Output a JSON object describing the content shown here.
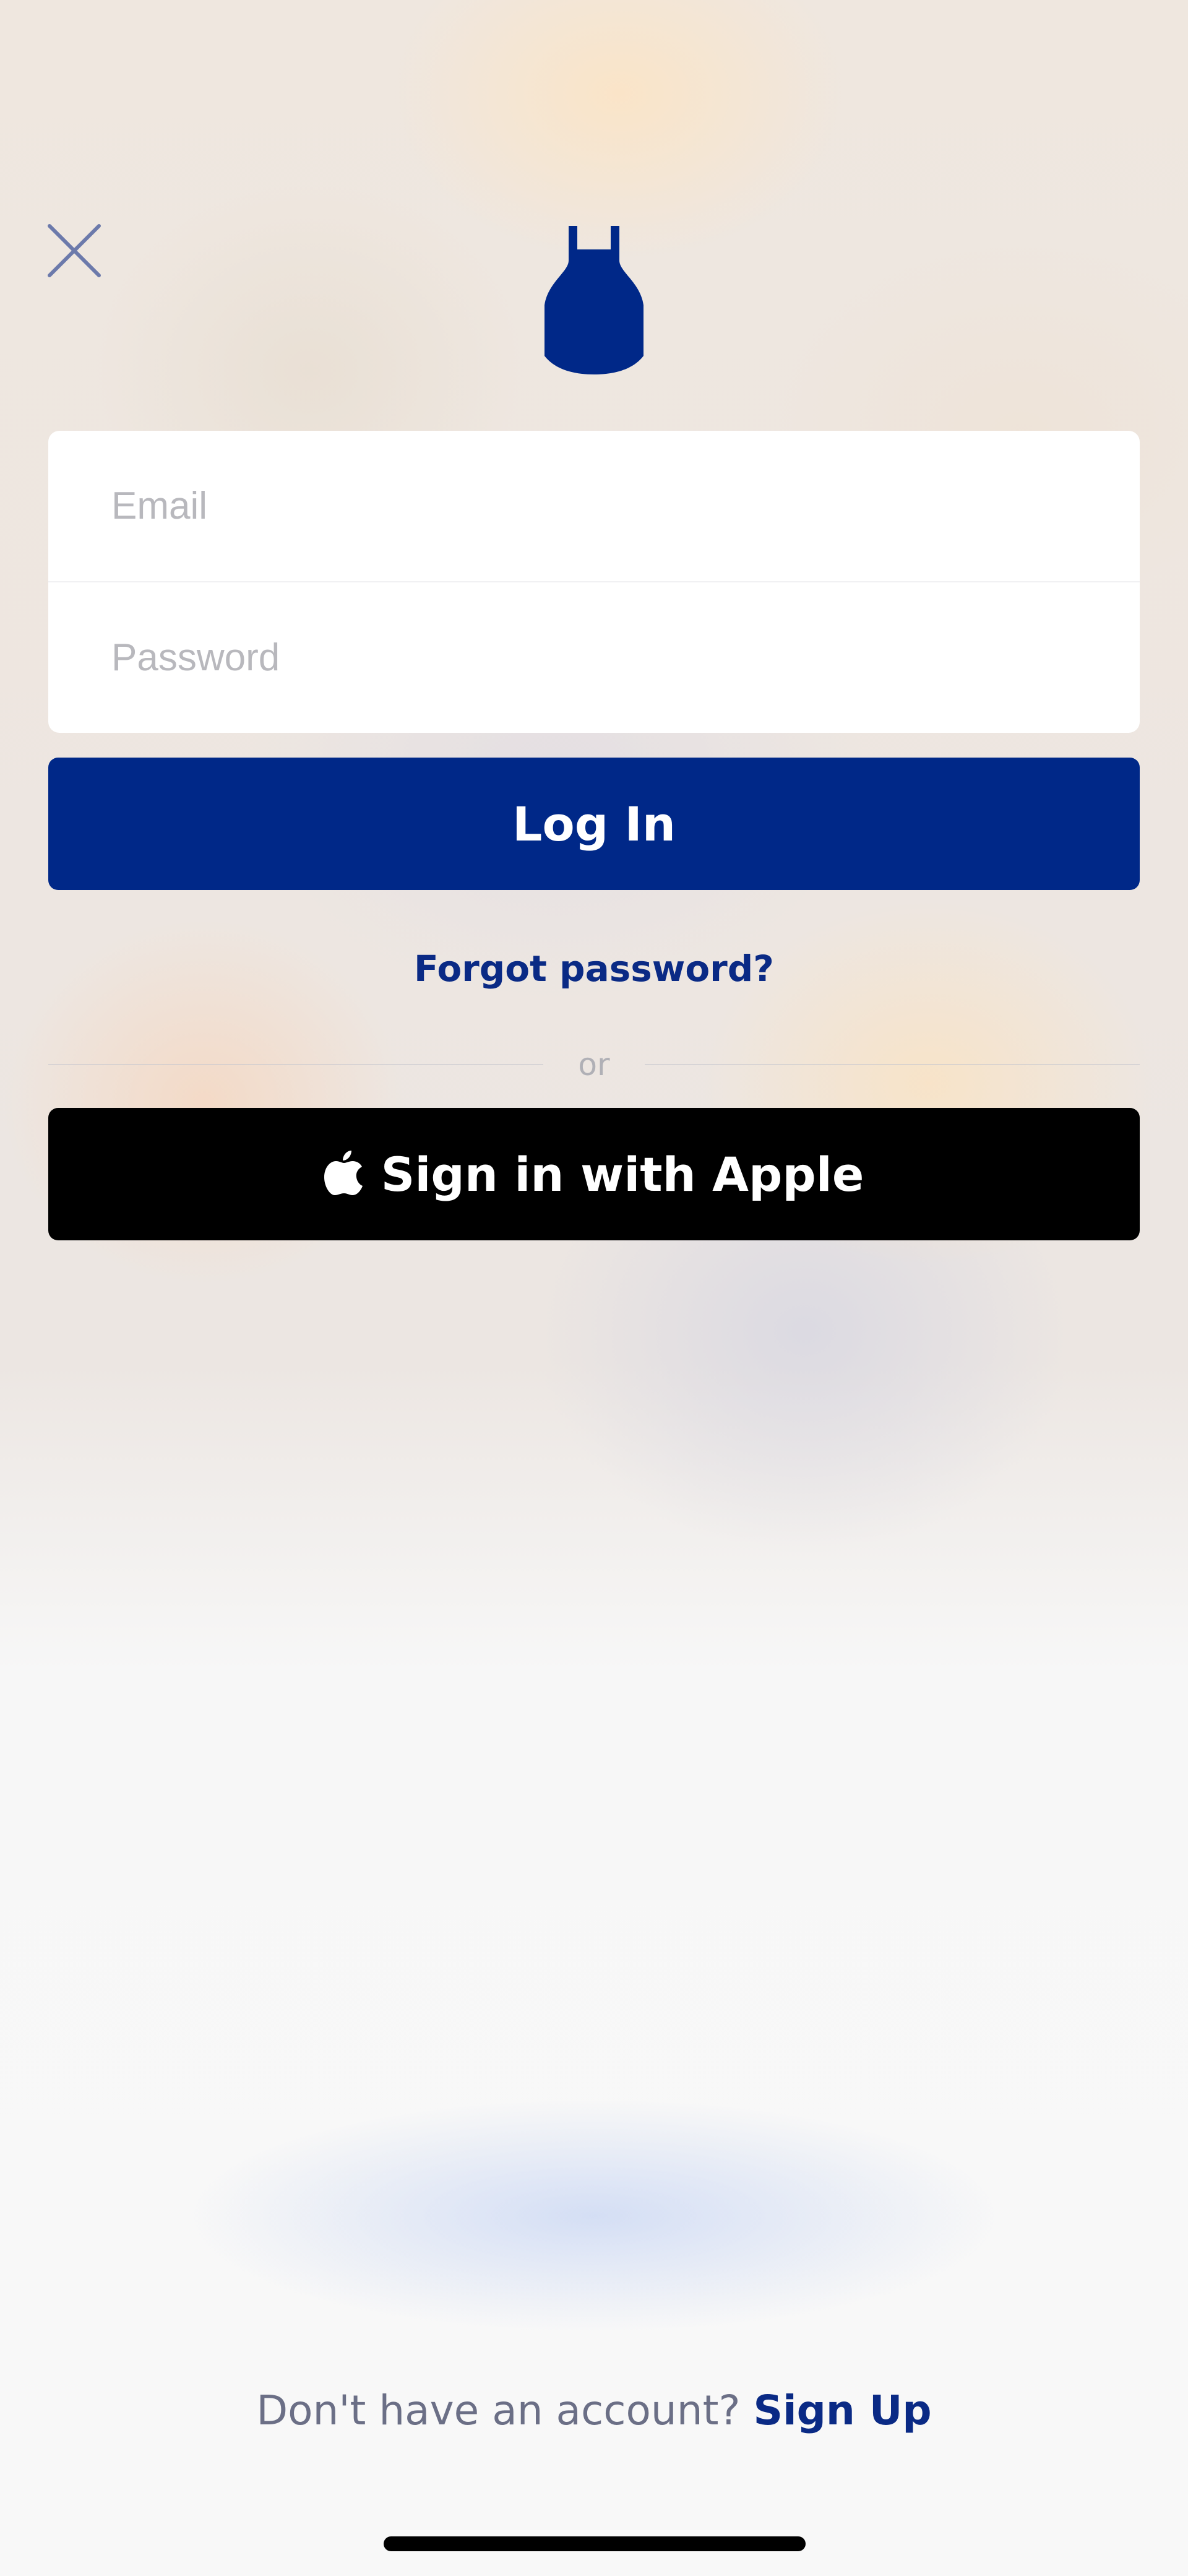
{
  "header": {
    "close_icon": "close-icon",
    "logo_icon": "apron-logo-icon"
  },
  "login_form": {
    "email_placeholder": "Email",
    "email_value": "",
    "password_placeholder": "Password",
    "password_value": "",
    "login_label": "Log In",
    "forgot_password_label": "Forgot password?",
    "divider_label": "or"
  },
  "apple_sign_in": {
    "icon": "apple-icon",
    "label": "Sign in with Apple"
  },
  "footer": {
    "prompt": "Don't have an account?",
    "signup_label": "Sign Up"
  },
  "colors": {
    "brand_blue": "#002888",
    "link_blue": "#0a2a85",
    "apple_black": "#000000",
    "muted_text": "#6b6f86",
    "placeholder": "#b8b8bd"
  }
}
